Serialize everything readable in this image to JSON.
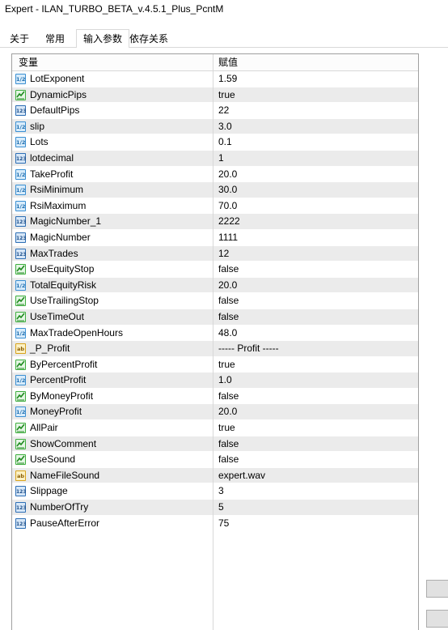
{
  "window": {
    "title": "Expert - ILAN_TURBO_BETA_v.4.5.1_Plus_PcntM"
  },
  "tabs": [
    {
      "label": "关于"
    },
    {
      "label": "常用"
    },
    {
      "label": "输入参数",
      "active": true
    },
    {
      "label": "依存关系"
    }
  ],
  "grid": {
    "headers": {
      "variable": "变量",
      "value": "赋值"
    },
    "rows": [
      {
        "name": "LotExponent",
        "value": "1.59",
        "type": "double",
        "icon": "double-type-icon"
      },
      {
        "name": "DynamicPips",
        "value": "true",
        "type": "bool",
        "icon": "bool-type-icon"
      },
      {
        "name": "DefaultPips",
        "value": "22",
        "type": "int",
        "icon": "int-type-icon"
      },
      {
        "name": "slip",
        "value": "3.0",
        "type": "double",
        "icon": "double-type-icon"
      },
      {
        "name": "Lots",
        "value": "0.1",
        "type": "double",
        "icon": "double-type-icon"
      },
      {
        "name": "lotdecimal",
        "value": "1",
        "type": "int",
        "icon": "int-type-icon"
      },
      {
        "name": "TakeProfit",
        "value": "20.0",
        "type": "double",
        "icon": "double-type-icon"
      },
      {
        "name": "RsiMinimum",
        "value": "30.0",
        "type": "double",
        "icon": "double-type-icon"
      },
      {
        "name": "RsiMaximum",
        "value": "70.0",
        "type": "double",
        "icon": "double-type-icon"
      },
      {
        "name": "MagicNumber_1",
        "value": "2222",
        "type": "int",
        "icon": "int-type-icon"
      },
      {
        "name": "MagicNumber",
        "value": "1111",
        "type": "int",
        "icon": "int-type-icon"
      },
      {
        "name": "MaxTrades",
        "value": "12",
        "type": "int",
        "icon": "int-type-icon"
      },
      {
        "name": "UseEquityStop",
        "value": "false",
        "type": "bool",
        "icon": "bool-type-icon"
      },
      {
        "name": "TotalEquityRisk",
        "value": "20.0",
        "type": "double",
        "icon": "double-type-icon"
      },
      {
        "name": "UseTrailingStop",
        "value": "false",
        "type": "bool",
        "icon": "bool-type-icon"
      },
      {
        "name": "UseTimeOut",
        "value": "false",
        "type": "bool",
        "icon": "bool-type-icon"
      },
      {
        "name": "MaxTradeOpenHours",
        "value": "48.0",
        "type": "double",
        "icon": "double-type-icon"
      },
      {
        "name": "_P_Profit",
        "value": "----- Profit -----",
        "type": "string",
        "icon": "string-type-icon"
      },
      {
        "name": "ByPercentProfit",
        "value": "true",
        "type": "bool",
        "icon": "bool-type-icon"
      },
      {
        "name": "PercentProfit",
        "value": "1.0",
        "type": "double",
        "icon": "double-type-icon"
      },
      {
        "name": "ByMoneyProfit",
        "value": "false",
        "type": "bool",
        "icon": "bool-type-icon"
      },
      {
        "name": "MoneyProfit",
        "value": "20.0",
        "type": "double",
        "icon": "double-type-icon"
      },
      {
        "name": "AllPair",
        "value": "true",
        "type": "bool",
        "icon": "bool-type-icon"
      },
      {
        "name": "ShowComment",
        "value": "false",
        "type": "bool",
        "icon": "bool-type-icon"
      },
      {
        "name": "UseSound",
        "value": "false",
        "type": "bool",
        "icon": "bool-type-icon"
      },
      {
        "name": "NameFileSound",
        "value": "expert.wav",
        "type": "string",
        "icon": "string-type-icon"
      },
      {
        "name": "Slippage",
        "value": "3",
        "type": "int",
        "icon": "int-type-icon"
      },
      {
        "name": "NumberOfTry",
        "value": "5",
        "type": "int",
        "icon": "int-type-icon"
      },
      {
        "name": "PauseAfterError",
        "value": "75",
        "type": "int",
        "icon": "int-type-icon"
      }
    ]
  },
  "icon_glyphs": {
    "double": "1/2",
    "int": "123",
    "string": "ab"
  },
  "colors": {
    "row_alt": "#ebebeb",
    "grid_border": "#a0a0a0",
    "bool_icon": "#3fae3f",
    "double_icon": "#3a8fd2",
    "int_icon": "#2e6fb5",
    "string_icon": "#d8a31c"
  }
}
